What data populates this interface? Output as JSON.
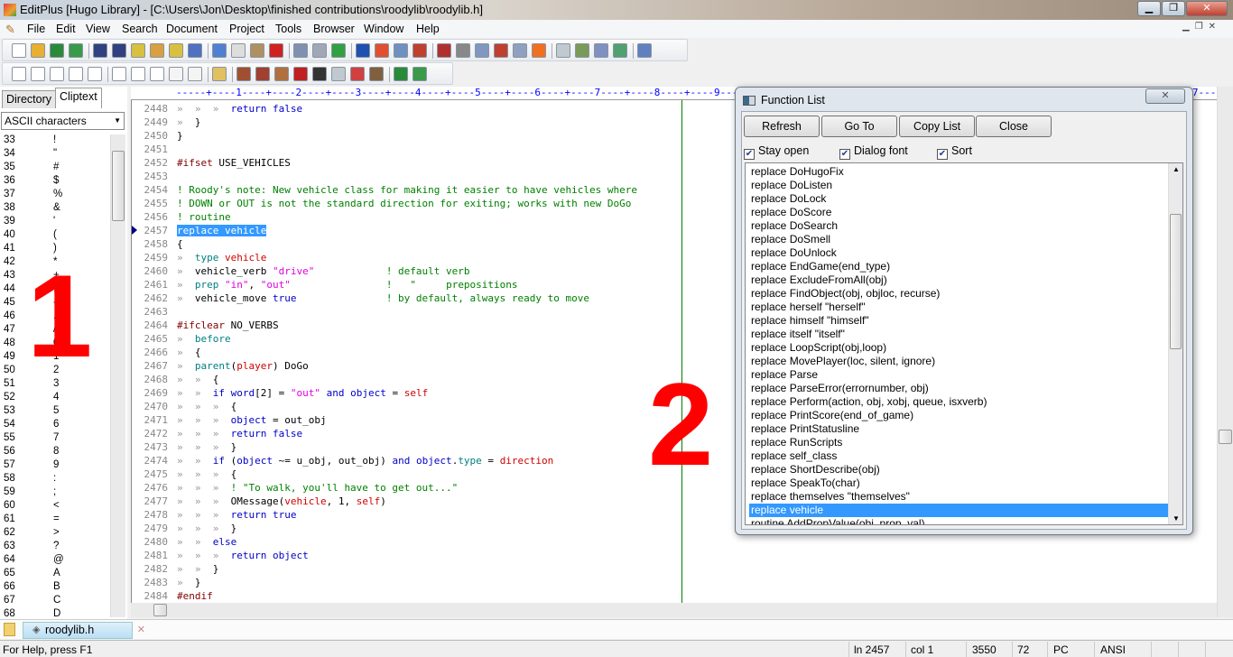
{
  "window": {
    "title": "EditPlus [Hugo Library] - [C:\\Users\\Jon\\Desktop\\finished contributions\\roodylib\\roodylib.h]",
    "min": "▁",
    "max": "❐",
    "close": "✕"
  },
  "menu": [
    "File",
    "Edit",
    "View",
    "Search",
    "Document",
    "Project",
    "Tools",
    "Browser",
    "Window",
    "Help"
  ],
  "toolbar1": [
    {
      "icon": "new-file",
      "c": "#fff"
    },
    {
      "icon": "open-folder",
      "c": "#e8b030"
    },
    {
      "icon": "save",
      "c": "#2a8a3a"
    },
    {
      "icon": "save-all",
      "c": "#3a9a4a"
    },
    null,
    {
      "icon": "indent",
      "c": "#304080"
    },
    {
      "icon": "unindent",
      "c": "#304080"
    },
    {
      "icon": "edit-note",
      "c": "#d8c040"
    },
    {
      "icon": "edit-note-x",
      "c": "#d8a040"
    },
    {
      "icon": "edit-note-arrow",
      "c": "#d8c040"
    },
    {
      "icon": "spellcheck",
      "c": "#5070c0"
    },
    null,
    {
      "icon": "cut",
      "c": "#5080d0"
    },
    {
      "icon": "copy",
      "c": "#ddd"
    },
    {
      "icon": "paste",
      "c": "#b09060"
    },
    {
      "icon": "delete",
      "c": "#d02020"
    },
    null,
    {
      "icon": "undo",
      "c": "#8090b0"
    },
    {
      "icon": "redo",
      "c": "#a0a8b8"
    },
    {
      "icon": "goto",
      "c": "#30a040"
    },
    null,
    {
      "icon": "find",
      "c": "#2050b0"
    },
    {
      "icon": "replace",
      "c": "#e05030"
    },
    {
      "icon": "find-in-files",
      "c": "#7090c0"
    },
    {
      "icon": "line-number",
      "c": "#c04030"
    },
    null,
    {
      "icon": "font",
      "c": "#b03030"
    },
    {
      "icon": "hex",
      "c": "#888"
    },
    {
      "icon": "word-wrap",
      "c": "#8098c0"
    },
    {
      "icon": "wrap-line",
      "c": "#c04030"
    },
    {
      "icon": "column",
      "c": "#90a0c0"
    },
    {
      "icon": "check",
      "c": "#f07020"
    },
    null,
    {
      "icon": "output-window",
      "c": "#c0c8d0"
    },
    {
      "icon": "cliptext-window",
      "c": "#7a9a5a"
    },
    {
      "icon": "directory-window",
      "c": "#8090c0"
    },
    {
      "icon": "full-screen",
      "c": "#50a070"
    },
    null,
    {
      "icon": "help",
      "c": "#6080c0"
    }
  ],
  "toolbar2": [
    {
      "icon": "user-tool-1",
      "c": "#fff"
    },
    {
      "icon": "user-tool-2",
      "c": "#fff"
    },
    {
      "icon": "user-tool-3",
      "c": "#fff"
    },
    {
      "icon": "user-tool-4",
      "c": "#fff"
    },
    {
      "icon": "user-tool-5",
      "c": "#fff"
    },
    null,
    {
      "icon": "user-tool-6",
      "c": "#fff"
    },
    {
      "icon": "user-tool-7",
      "c": "#fff"
    },
    {
      "icon": "user-tool-8",
      "c": "#fff"
    },
    {
      "icon": "user-tool-9",
      "c": "#f4f4f4"
    },
    {
      "icon": "user-tool-10",
      "c": "#f4f4f4"
    },
    null,
    {
      "icon": "configure-tools",
      "c": "#e0c060"
    },
    null,
    {
      "icon": "hugo-compile",
      "c": "#a05030"
    },
    {
      "icon": "hugo-debug",
      "c": "#a04030"
    },
    {
      "icon": "hugo-run",
      "c": "#b07040"
    },
    {
      "icon": "hugo-book",
      "c": "#c02020"
    },
    {
      "icon": "home",
      "c": "#333"
    },
    {
      "icon": "settings",
      "c": "#c0c8d0"
    },
    {
      "icon": "text-a",
      "c": "#d04040"
    },
    {
      "icon": "robot",
      "c": "#806040"
    },
    null,
    {
      "icon": "save-green",
      "c": "#2a8a3a"
    },
    {
      "icon": "save-all-green",
      "c": "#3a9a4a"
    }
  ],
  "left": {
    "tabs": [
      "Directory",
      "Cliptext"
    ],
    "dropdown": "ASCII characters",
    "dropdown_arrow": "▼",
    "chars": [
      [
        "33",
        "!"
      ],
      [
        "34",
        "\""
      ],
      [
        "35",
        "#"
      ],
      [
        "36",
        "$"
      ],
      [
        "37",
        "%"
      ],
      [
        "38",
        "&"
      ],
      [
        "39",
        "'"
      ],
      [
        "40",
        "("
      ],
      [
        "41",
        ")"
      ],
      [
        "42",
        "*"
      ],
      [
        "43",
        "+"
      ],
      [
        "44",
        ","
      ],
      [
        "45",
        "-"
      ],
      [
        "46",
        "."
      ],
      [
        "47",
        "/"
      ],
      [
        "48",
        "0"
      ],
      [
        "49",
        "1"
      ],
      [
        "50",
        "2"
      ],
      [
        "51",
        "3"
      ],
      [
        "52",
        "4"
      ],
      [
        "53",
        "5"
      ],
      [
        "54",
        "6"
      ],
      [
        "55",
        "7"
      ],
      [
        "56",
        "8"
      ],
      [
        "57",
        "9"
      ],
      [
        "58",
        ":"
      ],
      [
        "59",
        ";"
      ],
      [
        "60",
        "<"
      ],
      [
        "61",
        "="
      ],
      [
        "62",
        ">"
      ],
      [
        "63",
        "?"
      ],
      [
        "64",
        "@"
      ],
      [
        "65",
        "A"
      ],
      [
        "66",
        "B"
      ],
      [
        "67",
        "C"
      ],
      [
        "68",
        "D"
      ]
    ]
  },
  "ruler": "-----+----1----+----2----+----3----+----4----+----5----+----6----+----7----+----8----+----9----+----0----+----1----+----2----+----3----+----4----+----5----+----6----+----7----+",
  "code": [
    [
      "2448",
      [
        [
          "»  »  »  ",
          "tab"
        ],
        [
          "return false",
          "kw"
        ]
      ]
    ],
    [
      "2449",
      [
        [
          "»  ",
          "tab"
        ],
        [
          "}",
          "n"
        ]
      ]
    ],
    [
      "2450",
      [
        [
          "}",
          "n"
        ]
      ]
    ],
    [
      "2451",
      []
    ],
    [
      "2452",
      [
        [
          "#ifset",
          "pp"
        ],
        [
          " USE_VEHICLES",
          "n"
        ]
      ]
    ],
    [
      "2453",
      []
    ],
    [
      "2454",
      [
        [
          "! Roody's note: New vehicle class for making it easier to have vehicles where",
          "com"
        ]
      ]
    ],
    [
      "2455",
      [
        [
          "! DOWN or OUT is not the standard direction for exiting; works with new DoGo",
          "com"
        ]
      ]
    ],
    [
      "2456",
      [
        [
          "! routine",
          "com"
        ]
      ]
    ],
    [
      "2457",
      [
        [
          "replace vehicle",
          "sel"
        ]
      ]
    ],
    [
      "2458",
      [
        [
          "{",
          "n"
        ]
      ]
    ],
    [
      "2459",
      [
        [
          "»  ",
          "tab"
        ],
        [
          "type ",
          "teal"
        ],
        [
          "vehicle",
          "red"
        ]
      ]
    ],
    [
      "2460",
      [
        [
          "»  ",
          "tab"
        ],
        [
          "vehicle_verb ",
          "n"
        ],
        [
          "\"drive\"",
          "str"
        ],
        [
          "            ",
          "n"
        ],
        [
          "! default verb",
          "com"
        ]
      ]
    ],
    [
      "2461",
      [
        [
          "»  ",
          "tab"
        ],
        [
          "prep ",
          "teal"
        ],
        [
          "\"in\"",
          "str"
        ],
        [
          ", ",
          "n"
        ],
        [
          "\"out\"",
          "str"
        ],
        [
          "                ",
          "n"
        ],
        [
          "!   \"     prepositions",
          "com"
        ]
      ]
    ],
    [
      "2462",
      [
        [
          "»  ",
          "tab"
        ],
        [
          "vehicle_move ",
          "n"
        ],
        [
          "true",
          "kw"
        ],
        [
          "               ",
          "n"
        ],
        [
          "! by default, always ready to move",
          "com"
        ]
      ]
    ],
    [
      "2463",
      []
    ],
    [
      "2464",
      [
        [
          "#ifclear",
          "pp"
        ],
        [
          " NO_VERBS",
          "n"
        ]
      ]
    ],
    [
      "2465",
      [
        [
          "»  ",
          "tab"
        ],
        [
          "before",
          "teal"
        ]
      ]
    ],
    [
      "2466",
      [
        [
          "»  ",
          "tab"
        ],
        [
          "{",
          "n"
        ]
      ]
    ],
    [
      "2467",
      [
        [
          "»  ",
          "tab"
        ],
        [
          "parent",
          "teal"
        ],
        [
          "(",
          "n"
        ],
        [
          "player",
          "red"
        ],
        [
          ") DoGo",
          "n"
        ]
      ]
    ],
    [
      "2468",
      [
        [
          "»  »  ",
          "tab"
        ],
        [
          "{",
          "n"
        ]
      ]
    ],
    [
      "2469",
      [
        [
          "»  »  ",
          "tab"
        ],
        [
          "if word",
          "kw"
        ],
        [
          "[2] = ",
          "n"
        ],
        [
          "\"out\"",
          "str"
        ],
        [
          " and object",
          "kw"
        ],
        [
          " = ",
          "n"
        ],
        [
          "self",
          "red"
        ]
      ]
    ],
    [
      "2470",
      [
        [
          "»  »  »  ",
          "tab"
        ],
        [
          "{",
          "n"
        ]
      ]
    ],
    [
      "2471",
      [
        [
          "»  »  »  ",
          "tab"
        ],
        [
          "object",
          "kw"
        ],
        [
          " = out_obj",
          "n"
        ]
      ]
    ],
    [
      "2472",
      [
        [
          "»  »  »  ",
          "tab"
        ],
        [
          "return false",
          "kw"
        ]
      ]
    ],
    [
      "2473",
      [
        [
          "»  »  »  ",
          "tab"
        ],
        [
          "}",
          "n"
        ]
      ]
    ],
    [
      "2474",
      [
        [
          "»  »  ",
          "tab"
        ],
        [
          "if",
          "kw"
        ],
        [
          " (",
          "n"
        ],
        [
          "object",
          "kw"
        ],
        [
          " ~= u_obj, out_obj) ",
          "n"
        ],
        [
          "and object",
          "kw"
        ],
        [
          ".",
          "n"
        ],
        [
          "type",
          "teal"
        ],
        [
          " = ",
          "n"
        ],
        [
          "direction",
          "red"
        ]
      ]
    ],
    [
      "2475",
      [
        [
          "»  »  »  ",
          "tab"
        ],
        [
          "{",
          "n"
        ]
      ]
    ],
    [
      "2476",
      [
        [
          "»  »  »  ",
          "tab"
        ],
        [
          "! \"To walk, you'll have to get out...\"",
          "com"
        ]
      ]
    ],
    [
      "2477",
      [
        [
          "»  »  »  ",
          "tab"
        ],
        [
          "OMessage(",
          "n"
        ],
        [
          "vehicle",
          "red"
        ],
        [
          ", 1, ",
          "n"
        ],
        [
          "self",
          "red"
        ],
        [
          ")",
          "n"
        ]
      ]
    ],
    [
      "2478",
      [
        [
          "»  »  »  ",
          "tab"
        ],
        [
          "return true",
          "kw"
        ]
      ]
    ],
    [
      "2479",
      [
        [
          "»  »  »  ",
          "tab"
        ],
        [
          "}",
          "n"
        ]
      ]
    ],
    [
      "2480",
      [
        [
          "»  »  ",
          "tab"
        ],
        [
          "else",
          "kw"
        ]
      ]
    ],
    [
      "2481",
      [
        [
          "»  »  »  ",
          "tab"
        ],
        [
          "return object",
          "kw"
        ]
      ]
    ],
    [
      "2482",
      [
        [
          "»  »  ",
          "tab"
        ],
        [
          "}",
          "n"
        ]
      ]
    ],
    [
      "2483",
      [
        [
          "»  ",
          "tab"
        ],
        [
          "}",
          "n"
        ]
      ]
    ],
    [
      "2484",
      [
        [
          "#endif",
          "pp"
        ]
      ]
    ]
  ],
  "doc_tab": "roodylib.h",
  "status": {
    "help": "For Help, press F1",
    "line": "ln 2457",
    "col": "col 1",
    "chars": "3550",
    "number": "72",
    "eol": "PC",
    "encoding": "ANSI"
  },
  "dialog": {
    "title": "Function List",
    "close": "✕",
    "buttons": [
      "Refresh",
      "Go To",
      "Copy List",
      "Close"
    ],
    "checks": [
      {
        "label": "Stay open",
        "checked": true
      },
      {
        "label": "Dialog font",
        "checked": true
      },
      {
        "label": "Sort",
        "checked": true
      }
    ],
    "items": [
      "replace DoHugoFix",
      "replace DoListen",
      "replace DoLock",
      "replace DoScore",
      "replace DoSearch",
      "replace DoSmell",
      "replace DoUnlock",
      "replace EndGame(end_type)",
      "replace ExcludeFromAll(obj)",
      "replace FindObject(obj, objloc, recurse)",
      "replace herself \"herself\"",
      "replace himself \"himself\"",
      "replace itself \"itself\"",
      "replace LoopScript(obj,loop)",
      "replace MovePlayer(loc, silent, ignore)",
      "replace Parse",
      "replace ParseError(errornumber, obj)",
      "replace Perform(action, obj, xobj, queue, isxverb)",
      "replace PrintScore(end_of_game)",
      "replace PrintStatusline",
      "replace RunScripts",
      "replace self_class",
      "replace ShortDescribe(obj)",
      "replace SpeakTo(char)",
      "replace themselves \"themselves\"",
      "replace vehicle",
      "routine AddPropValue(obj, prop, val)"
    ],
    "selected": "replace vehicle"
  },
  "annotations": [
    "1",
    "2"
  ]
}
